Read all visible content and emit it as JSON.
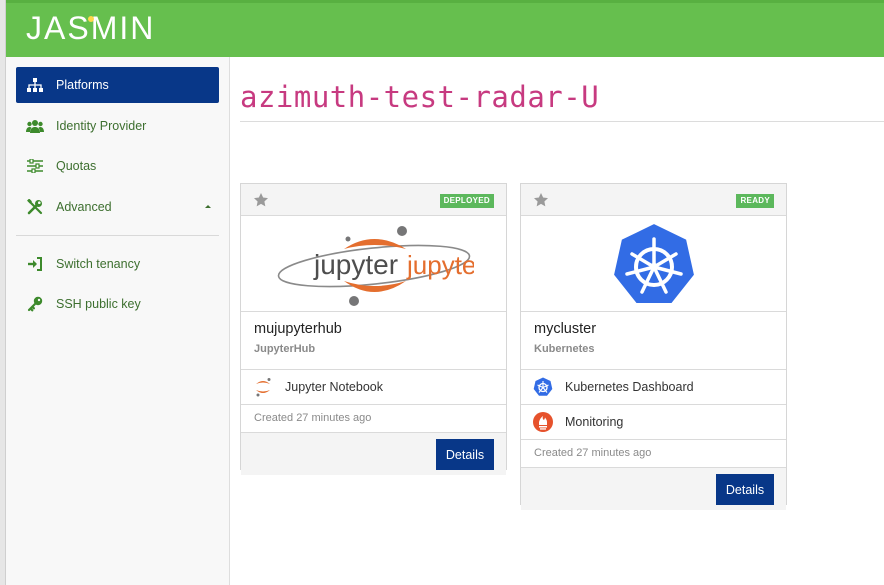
{
  "app": {
    "logo_text": "JASMIN"
  },
  "sidebar": {
    "items": [
      {
        "label": "Platforms",
        "icon": "sitemap-icon",
        "active": true
      },
      {
        "label": "Identity Provider",
        "icon": "users-icon"
      },
      {
        "label": "Quotas",
        "icon": "sliders-icon"
      },
      {
        "label": "Advanced",
        "icon": "tools-icon",
        "expanded": true
      },
      {
        "label": "Switch tenancy",
        "icon": "sign-in-icon"
      },
      {
        "label": "SSH public key",
        "icon": "key-icon"
      }
    ]
  },
  "main": {
    "title": "azimuth-test-radar-U",
    "cards": [
      {
        "status": "DEPLOYED",
        "logo_text": "jupyterhub",
        "name": "mujupyterhub",
        "type": "JupyterHub",
        "services": [
          {
            "label": "Jupyter Notebook",
            "icon": "jupyter-icon"
          }
        ],
        "created": "Created 27 minutes ago",
        "details_label": "Details"
      },
      {
        "status": "READY",
        "logo_icon": "kubernetes-logo-icon",
        "name": "mycluster",
        "type": "Kubernetes",
        "services": [
          {
            "label": "Kubernetes Dashboard",
            "icon": "kubernetes-icon"
          },
          {
            "label": "Monitoring",
            "icon": "prometheus-icon"
          }
        ],
        "created": "Created 27 minutes ago",
        "details_label": "Details"
      }
    ]
  },
  "colors": {
    "header_green": "#66bf4e",
    "nav_active": "#083788",
    "title_pink": "#c73a80",
    "badge_green": "#5cb85c",
    "button_navy": "#083788"
  }
}
